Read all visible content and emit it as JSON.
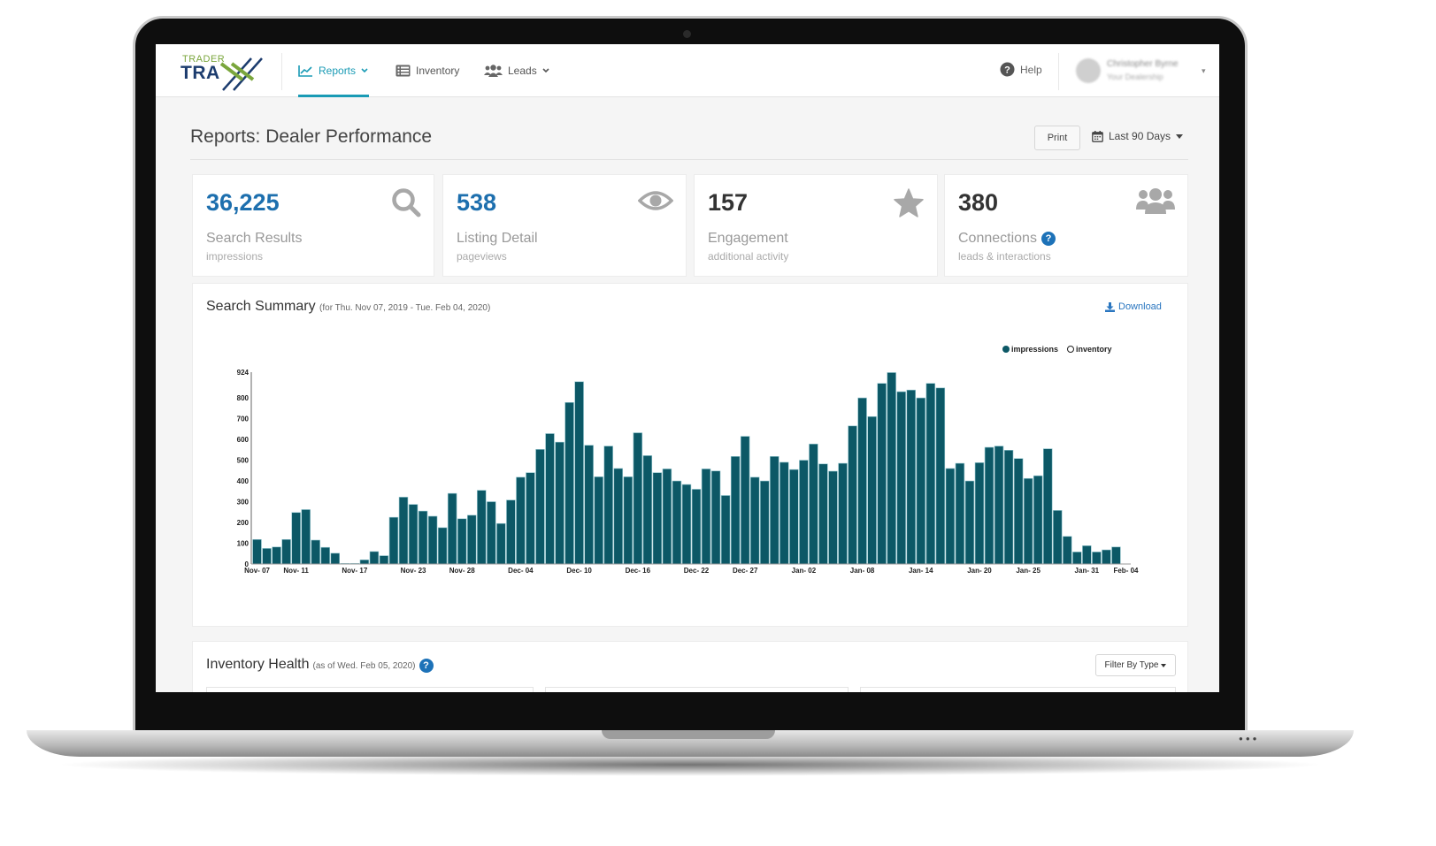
{
  "app": {
    "logo_top": "TRADER",
    "logo_bottom": "TRA"
  },
  "nav": {
    "items": [
      {
        "label": "Reports",
        "icon": "line-chart-icon",
        "has_caret": true,
        "active": true
      },
      {
        "label": "Inventory",
        "icon": "list-icon",
        "has_caret": false,
        "active": false
      },
      {
        "label": "Leads",
        "icon": "users-icon",
        "has_caret": true,
        "active": false
      }
    ],
    "help_label": "Help",
    "user_name": "Christopher Byrne",
    "user_sub": "Your Dealership"
  },
  "header": {
    "title": "Reports: Dealer Performance",
    "print_label": "Print",
    "range_label": "Last 90 Days"
  },
  "stats": [
    {
      "value": "36,225",
      "label": "Search Results",
      "sub": "impressions",
      "icon": "search-icon",
      "color": "#1d6fae"
    },
    {
      "value": "538",
      "label": "Listing Detail",
      "sub": "pageviews",
      "icon": "eye-icon",
      "color": "#1d6fae"
    },
    {
      "value": "157",
      "label": "Engagement",
      "sub": "additional activity",
      "icon": "star-icon",
      "color": "#333333"
    },
    {
      "value": "380",
      "label": "Connections",
      "sub": "leads & interactions",
      "icon": "users-icon",
      "color": "#333333",
      "help": true
    }
  ],
  "search_summary": {
    "title": "Search Summary",
    "range": "(for Thu. Nov 07, 2019 - Tue. Feb 04, 2020)",
    "download_label": "Download",
    "legend": [
      "impressions",
      "inventory"
    ]
  },
  "chart_data": {
    "type": "bar",
    "title": "Search Summary",
    "xlabel": "",
    "ylabel": "",
    "ylim": [
      0,
      924
    ],
    "yticks": [
      0,
      100,
      200,
      300,
      400,
      500,
      600,
      700,
      800,
      924
    ],
    "xtick_labels": [
      "Nov- 07",
      "Nov- 11",
      "Nov- 17",
      "Nov- 23",
      "Nov- 28",
      "Dec- 04",
      "Dec- 10",
      "Dec- 16",
      "Dec- 22",
      "Dec- 27",
      "Jan- 02",
      "Jan- 08",
      "Jan- 14",
      "Jan- 20",
      "Jan- 25",
      "Jan- 31",
      "Feb- 04"
    ],
    "xtick_indices": [
      0,
      4,
      10,
      16,
      21,
      27,
      33,
      39,
      45,
      50,
      56,
      62,
      68,
      74,
      79,
      85,
      89
    ],
    "legend": [
      "impressions",
      "inventory"
    ],
    "legend_placement": "top-right",
    "series": [
      {
        "name": "impressions",
        "color": "#0c5866",
        "values": [
          118,
          75,
          82,
          118,
          248,
          262,
          115,
          80,
          52,
          3,
          3,
          20,
          60,
          40,
          225,
          322,
          287,
          255,
          230,
          175,
          340,
          218,
          235,
          355,
          300,
          195,
          308,
          418,
          440,
          552,
          628,
          587,
          778,
          878,
          572,
          420,
          568,
          460,
          420,
          632,
          522,
          440,
          458,
          400,
          383,
          360,
          458,
          448,
          330,
          518,
          615,
          418,
          400,
          518,
          490,
          455,
          500,
          578,
          482,
          447,
          485,
          665,
          800,
          710,
          870,
          922,
          830,
          838,
          800,
          870,
          848,
          460,
          485,
          400,
          488,
          562,
          568,
          548,
          508,
          412,
          425,
          555,
          258,
          133,
          58,
          88,
          58,
          68,
          82,
          0
        ]
      }
    ]
  },
  "inventory_health": {
    "title": "Inventory Health",
    "as_of": "(as of Wed. Feb 05, 2020)",
    "filter_label": "Filter By Type"
  }
}
